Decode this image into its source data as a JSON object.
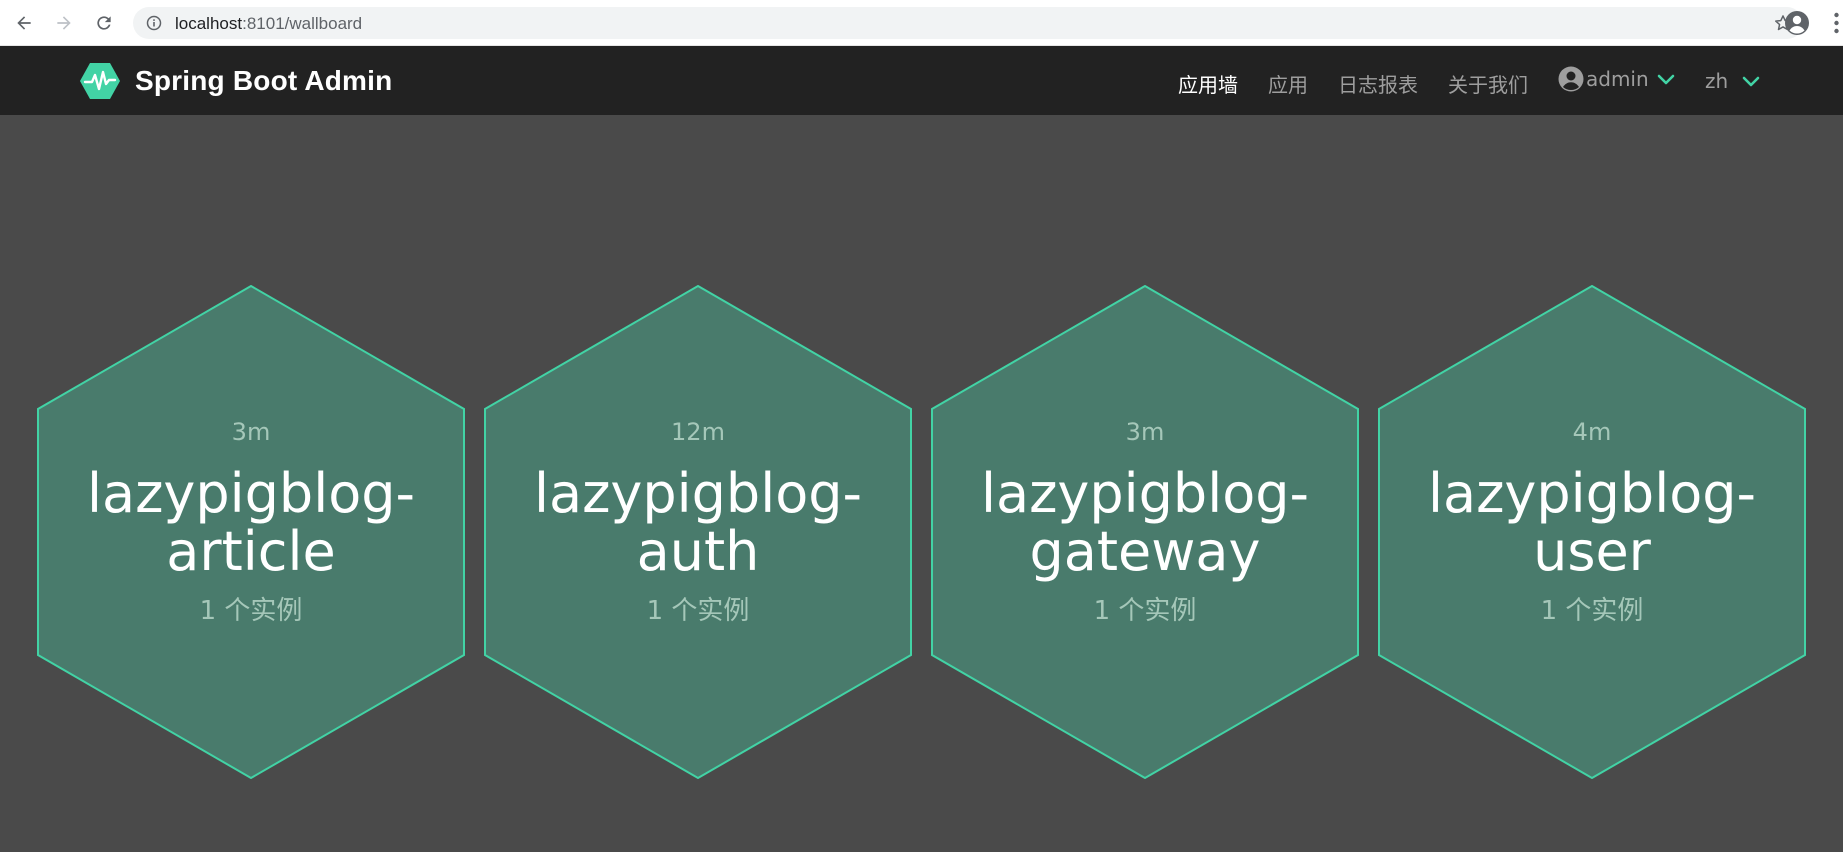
{
  "browser": {
    "url_host": "localhost",
    "url_rest": ":8101/wallboard"
  },
  "navbar": {
    "brand_title": "Spring Boot Admin",
    "items": [
      {
        "label": "应用墙",
        "active": true
      },
      {
        "label": "应用",
        "active": false
      },
      {
        "label": "日志报表",
        "active": false
      },
      {
        "label": "关于我们",
        "active": false
      }
    ],
    "user_label": "admin",
    "language_label": "zh"
  },
  "colors": {
    "accent": "#42d3a5",
    "hex_fill": "#497b6c",
    "background": "#4a4a4a",
    "navbar": "#222222"
  },
  "applications": [
    {
      "uptime": "3m",
      "name": "lazypigblog-article",
      "name_line1": "lazypigblog-",
      "name_line2": "article",
      "instances": "1 个实例"
    },
    {
      "uptime": "12m",
      "name": "lazypigblog-auth",
      "name_line1": "lazypigblog-",
      "name_line2": "auth",
      "instances": "1 个实例"
    },
    {
      "uptime": "3m",
      "name": "lazypigblog-gateway",
      "name_line1": "lazypigblog-",
      "name_line2": "gateway",
      "instances": "1 个实例"
    },
    {
      "uptime": "4m",
      "name": "lazypigblog-user",
      "name_line1": "lazypigblog-",
      "name_line2": "user",
      "instances": "1 个实例"
    }
  ]
}
